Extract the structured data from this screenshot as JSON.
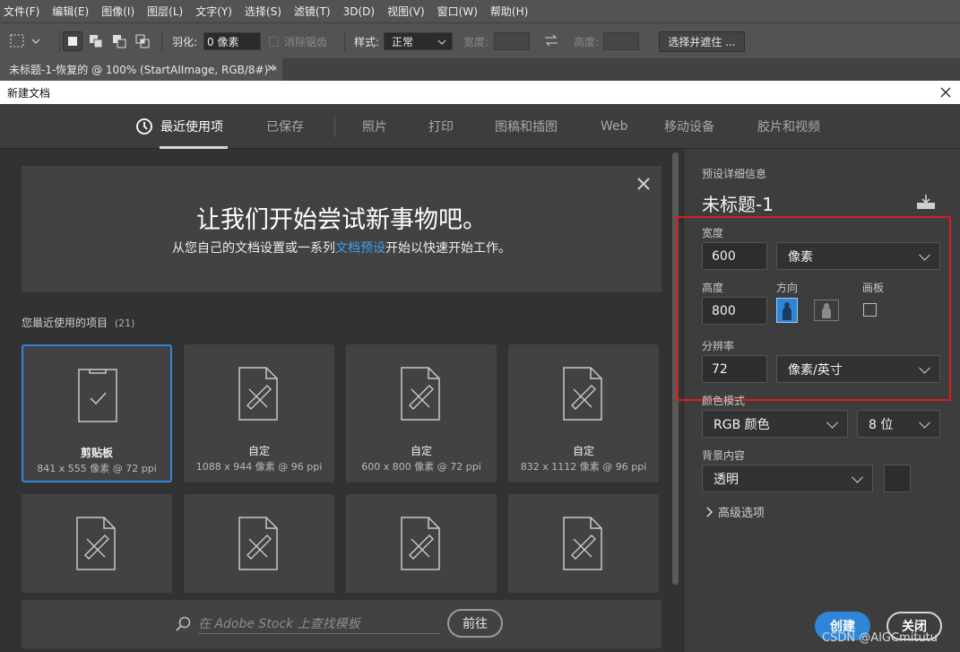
{
  "menu": [
    "文件(F)",
    "编辑(E)",
    "图像(I)",
    "图层(L)",
    "文字(Y)",
    "选择(S)",
    "滤镜(T)",
    "3D(D)",
    "视图(V)",
    "窗口(W)",
    "帮助(H)"
  ],
  "options": {
    "feather_label": "羽化:",
    "feather_value": "0 像素",
    "antialias_label": "消除锯齿",
    "style_label": "样式:",
    "style_value": "正常",
    "width_label": "宽度:",
    "height_label": "高度:",
    "select_mask_button": "选择并遮住 ..."
  },
  "document_tab": "未标题-1-恢复的 @ 100% (StartAIImage, RGB/8#) *",
  "dialog": {
    "title": "新建文档",
    "tabs": [
      "最近使用项",
      "已保存",
      "照片",
      "打印",
      "图稿和插图",
      "Web",
      "移动设备",
      "胶片和视频"
    ],
    "banner": {
      "headline": "让我们开始尝试新事物吧。",
      "text_before": "从您自己的文档设置或一系列",
      "link": "文档预设",
      "text_after": "开始以快速开始工作。"
    },
    "recent": {
      "label": "您最近使用的项目",
      "count": "(21)",
      "items": [
        {
          "title": "剪贴板",
          "sub": "841 x 555 像素 @ 72 ppi"
        },
        {
          "title": "自定",
          "sub": "1088 x 944 像素 @ 96 ppi"
        },
        {
          "title": "自定",
          "sub": "600 x 800 像素 @ 72 ppi"
        },
        {
          "title": "自定",
          "sub": "832 x 1112 像素 @ 96 ppi"
        }
      ]
    },
    "stock": {
      "placeholder": "在 Adobe Stock 上查找模板",
      "go_button": "前往"
    },
    "preset": {
      "section_label": "预设详细信息",
      "name": "未标题-1",
      "width_label": "宽度",
      "width_value": "600",
      "width_unit": "像素",
      "height_label": "高度",
      "height_value": "800",
      "orientation_label": "方向",
      "artboard_label": "画板",
      "resolution_label": "分辨率",
      "resolution_value": "72",
      "resolution_unit": "像素/英寸",
      "color_mode_label": "颜色模式",
      "color_mode_value": "RGB 颜色",
      "bit_depth_value": "8 位",
      "background_label": "背景内容",
      "background_value": "透明",
      "advanced_label": "高级选项"
    },
    "create_button": "创建",
    "close_button": "关闭"
  },
  "watermark": "CSDN @AIGCmitutu",
  "colors": {
    "accent": "#2f86d6",
    "highlight_box": "#d91d1d",
    "link": "#3d9fe8"
  }
}
